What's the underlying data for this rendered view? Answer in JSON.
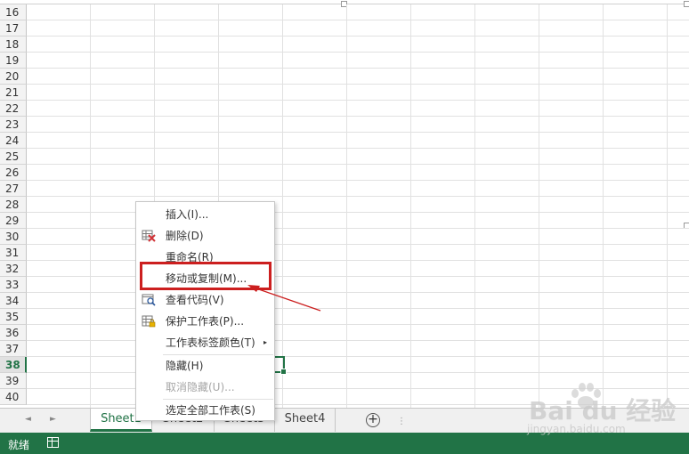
{
  "grid": {
    "rows": [
      "16",
      "17",
      "18",
      "19",
      "20",
      "21",
      "22",
      "23",
      "24",
      "25",
      "26",
      "27",
      "28",
      "29",
      "30",
      "31",
      "32",
      "33",
      "34",
      "35",
      "36",
      "37",
      "38",
      "39",
      "40"
    ],
    "active_row": "38"
  },
  "sheet_tabs": {
    "tabs": [
      "Sheet1",
      "Sheet2",
      "Sheet3",
      "Sheet4"
    ],
    "active": "Sheet1",
    "prev_icon": "◄",
    "next_icon": "►",
    "add_icon": "+",
    "more_icon": "⋮"
  },
  "status_bar": {
    "text": "就绪",
    "color": "#217346"
  },
  "context_menu": {
    "items": [
      {
        "label": "插入(I)...",
        "icon": "none"
      },
      {
        "label": "删除(D)",
        "icon": "delete-sheet-icon"
      },
      {
        "label": "重命名(R)",
        "icon": "none"
      },
      {
        "label": "移动或复制(M)...",
        "icon": "none"
      },
      {
        "label": "查看代码(V)",
        "icon": "view-code-icon"
      },
      {
        "label": "保护工作表(P)...",
        "icon": "protect-sheet-icon"
      },
      {
        "label": "工作表标签颜色(T)",
        "icon": "none",
        "submenu": "▸"
      },
      {
        "label": "隐藏(H)",
        "icon": "none"
      },
      {
        "label": "取消隐藏(U)...",
        "icon": "none",
        "disabled": true
      },
      {
        "label": "选定全部工作表(S)",
        "icon": "none"
      }
    ],
    "highlighted": "移动或复制(M)...",
    "highlight_color": "#cc1f1f"
  },
  "watermark": {
    "brand": "Bai du 经验",
    "url": "jingyan.baidu.com"
  }
}
